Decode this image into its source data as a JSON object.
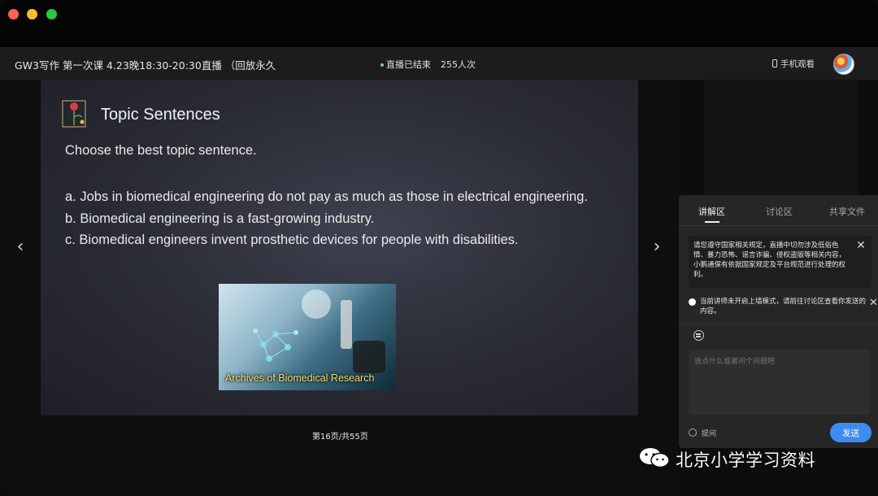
{
  "header": {
    "course_title": "GW3写作 第一次课 4.23晚18:30-20:30直播 （回放永久",
    "live_status": "直播已结束",
    "viewer_count": "255人次",
    "mobile_view": "手机观看"
  },
  "slide": {
    "title": "Topic Sentences",
    "prompt": "Choose the best topic sentence.",
    "options": [
      "a. Jobs in biomedical engineering do not pay as much as those in electrical engineering.",
      "b. Biomedical engineering is a fast-growing industry.",
      "c. Biomedical engineers invent prosthetic devices for people with disabilities."
    ],
    "image_caption": "Archives of Biomedical Research"
  },
  "pagination": {
    "indicator": "第16页/共55页",
    "prev_icon": "chevron-left-icon",
    "next_icon": "chevron-right-icon"
  },
  "panel": {
    "tabs": [
      "讲解区",
      "讨论区",
      "共享文件"
    ],
    "active_tab": 0,
    "notice": "请您遵守国家相关规定，直播中切勿涉及低俗色情、暴力恐怖、谣言诈骗、侵权盗版等相关内容，小鹅通保有依据国家规定及平台规范进行处理的权利。",
    "hint": "当前讲师未开启上墙模式，请前往讨论区查看你发送的内容。",
    "input_placeholder": "说点什么或者问个问题吧",
    "ask_label": "提问",
    "send_label": "发送"
  },
  "watermark": {
    "text": "北京小学学习资料"
  },
  "colors": {
    "accent": "#3d8bf0",
    "panel_bg": "#262626",
    "slide_bg": "#2c2e38"
  }
}
